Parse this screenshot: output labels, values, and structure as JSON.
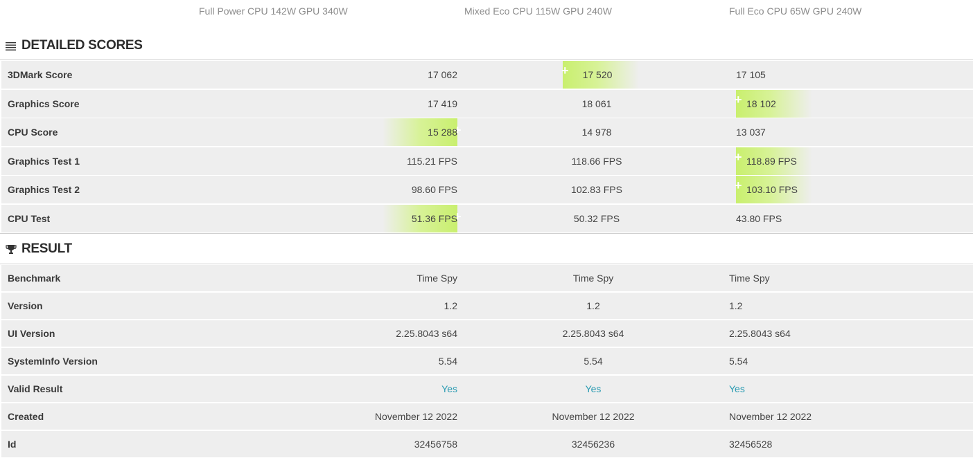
{
  "columns": [
    "Full Power CPU 142W GPU 340W",
    "Mixed Eco CPU 115W GPU 240W",
    "Full Eco CPU 65W GPU 240W"
  ],
  "detailed_scores": {
    "title": "DETAILED SCORES",
    "icon": "list-icon",
    "rows": [
      {
        "label": "3DMark Score",
        "values": [
          "17 062",
          "17 520",
          "17 105"
        ],
        "winner": 1
      },
      {
        "label": "Graphics Score",
        "values": [
          "17 419",
          "18 061",
          "18 102"
        ],
        "winner": 2
      },
      {
        "label": "CPU Score",
        "values": [
          "15 288",
          "14 978",
          "13 037"
        ],
        "winner": 0
      },
      {
        "label": "Graphics Test 1",
        "values": [
          "115.21 FPS",
          "118.66 FPS",
          "118.89 FPS"
        ],
        "winner": 2
      },
      {
        "label": "Graphics Test 2",
        "values": [
          "98.60 FPS",
          "102.83 FPS",
          "103.10 FPS"
        ],
        "winner": 2
      },
      {
        "label": "CPU Test",
        "values": [
          "51.36 FPS",
          "50.32 FPS",
          "43.80 FPS"
        ],
        "winner": 0
      }
    ]
  },
  "result": {
    "title": "RESULT",
    "icon": "trophy-icon",
    "rows": [
      {
        "label": "Benchmark",
        "values": [
          "Time Spy",
          "Time Spy",
          "Time Spy"
        ]
      },
      {
        "label": "Version",
        "values": [
          "1.2",
          "1.2",
          "1.2"
        ]
      },
      {
        "label": "UI Version",
        "values": [
          "2.25.8043 s64",
          "2.25.8043 s64",
          "2.25.8043 s64"
        ]
      },
      {
        "label": "SystemInfo Version",
        "values": [
          "5.54",
          "5.54",
          "5.54"
        ]
      },
      {
        "label": "Valid Result",
        "values": [
          "Yes",
          "Yes",
          "Yes"
        ],
        "link": true
      },
      {
        "label": "Created",
        "values": [
          "November 12 2022",
          "November 12 2022",
          "November 12 2022"
        ]
      },
      {
        "label": "Id",
        "values": [
          "32456758",
          "32456236",
          "32456528"
        ]
      }
    ]
  },
  "colors": {
    "highlight": "#c9ef6e",
    "link": "#2a9bb2",
    "row_bg": "#eeeeee"
  }
}
